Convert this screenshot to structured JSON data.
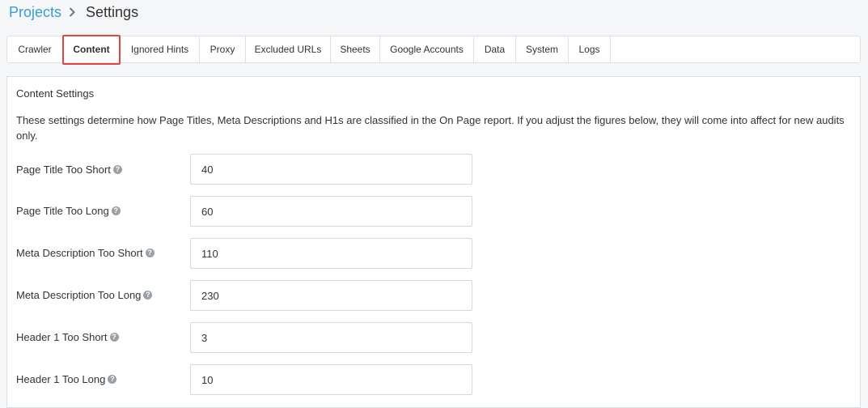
{
  "breadcrumb": {
    "parent": "Projects",
    "current": "Settings"
  },
  "tabs": [
    {
      "label": "Crawler"
    },
    {
      "label": "Content"
    },
    {
      "label": "Ignored Hints"
    },
    {
      "label": "Proxy"
    },
    {
      "label": "Excluded URLs"
    },
    {
      "label": "Sheets"
    },
    {
      "label": "Google Accounts"
    },
    {
      "label": "Data"
    },
    {
      "label": "System"
    },
    {
      "label": "Logs"
    }
  ],
  "active_tab": "Content",
  "content": {
    "title": "Content Settings",
    "description": "These settings determine how Page Titles, Meta Descriptions and H1s are classified in the On Page report. If you adjust the figures below, they will come into affect for new audits only.",
    "fields": [
      {
        "label": "Page Title Too Short",
        "value": "40"
      },
      {
        "label": "Page Title Too Long",
        "value": "60"
      },
      {
        "label": "Meta Description Too Short",
        "value": "110"
      },
      {
        "label": "Meta Description Too Long",
        "value": "230"
      },
      {
        "label": "Header 1 Too Short",
        "value": "3"
      },
      {
        "label": "Header 1 Too Long",
        "value": "10"
      }
    ]
  },
  "colors": {
    "link": "#3a9bd5",
    "active_highlight": "#e0453f"
  }
}
